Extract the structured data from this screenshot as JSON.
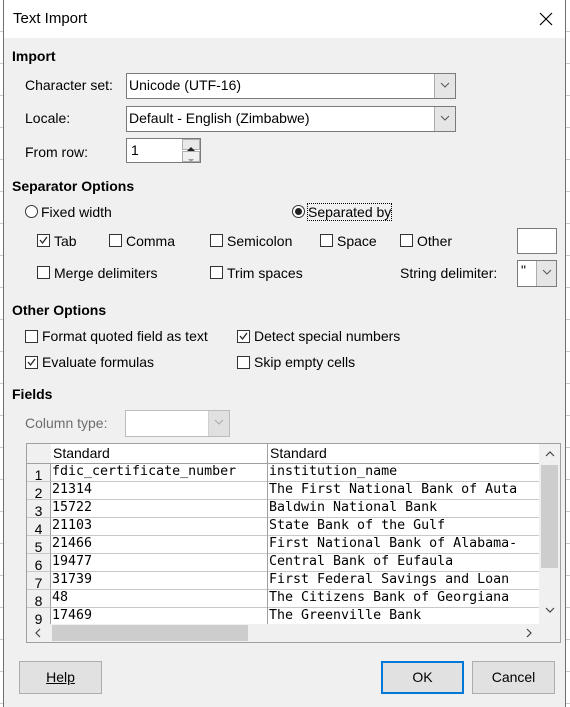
{
  "dialog": {
    "title": "Text Import",
    "close_icon": "close-icon"
  },
  "import": {
    "heading": "Import",
    "character_set": {
      "label": "Character set:",
      "value": "Unicode (UTF-16)"
    },
    "locale": {
      "label": "Locale:",
      "value": "Default - English (Zimbabwe)"
    },
    "from_row": {
      "label": "From row:",
      "value": "1"
    }
  },
  "separator_options": {
    "heading": "Separator Options",
    "fixed_width": {
      "label": "Fixed width",
      "selected": false
    },
    "separated_by": {
      "label": "Separated by",
      "selected": true
    },
    "tab": {
      "label": "Tab",
      "checked": true
    },
    "comma": {
      "label": "Comma",
      "checked": false
    },
    "semicolon": {
      "label": "Semicolon",
      "checked": false
    },
    "space": {
      "label": "Space",
      "checked": false
    },
    "other": {
      "label": "Other",
      "checked": false,
      "value": ""
    },
    "merge_delimiters": {
      "label": "Merge delimiters",
      "checked": false
    },
    "trim_spaces": {
      "label": "Trim spaces",
      "checked": false
    },
    "string_delimiter": {
      "label": "String delimiter:",
      "value": "\""
    }
  },
  "other_options": {
    "heading": "Other Options",
    "format_quoted": {
      "label": "Format quoted field as text",
      "checked": false
    },
    "detect_special": {
      "label": "Detect special numbers",
      "checked": true
    },
    "evaluate_formulas": {
      "label": "Evaluate formulas",
      "checked": true
    },
    "skip_empty": {
      "label": "Skip empty cells",
      "checked": false
    }
  },
  "fields": {
    "heading": "Fields",
    "column_type": {
      "label": "Column type:",
      "value": ""
    },
    "columns": [
      "Standard",
      "Standard"
    ],
    "rows": [
      {
        "num": "1",
        "cells": [
          "fdic_certificate_number",
          "institution_name"
        ]
      },
      {
        "num": "2",
        "cells": [
          "21314",
          "The First National Bank of Auta"
        ]
      },
      {
        "num": "3",
        "cells": [
          "15722",
          "Baldwin National Bank"
        ]
      },
      {
        "num": "4",
        "cells": [
          "21103",
          "State Bank of the Gulf"
        ]
      },
      {
        "num": "5",
        "cells": [
          "21466",
          "First National Bank of Alabama-"
        ]
      },
      {
        "num": "6",
        "cells": [
          "19477",
          "Central Bank of Eufaula"
        ]
      },
      {
        "num": "7",
        "cells": [
          "31739",
          "First Federal Savings and Loan"
        ]
      },
      {
        "num": "8",
        "cells": [
          "48",
          "The Citizens Bank of Georgiana"
        ]
      },
      {
        "num": "9",
        "cells": [
          "17469",
          "The Greenville Bank"
        ]
      }
    ]
  },
  "buttons": {
    "help": "Help",
    "ok": "OK",
    "cancel": "Cancel"
  }
}
